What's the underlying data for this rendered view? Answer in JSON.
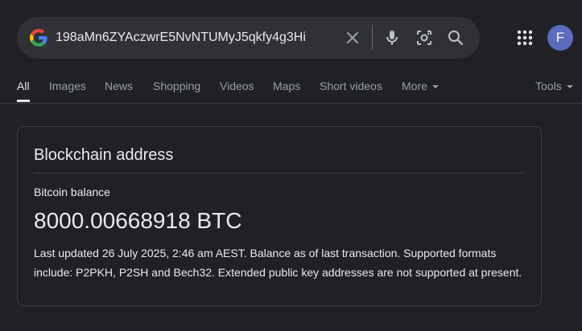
{
  "search": {
    "query": "198aMn6ZYAczwrE5NvNTUMyJ5qkfy4g3Hi",
    "icons": [
      "google-logo",
      "clear-icon",
      "microphone-icon",
      "camera-lens-icon",
      "search-icon"
    ]
  },
  "account": {
    "initial": "F",
    "avatar_color": "#5c6bc0"
  },
  "tabs": [
    {
      "label": "All"
    },
    {
      "label": "Images"
    },
    {
      "label": "News"
    },
    {
      "label": "Shopping"
    },
    {
      "label": "Videos"
    },
    {
      "label": "Maps"
    },
    {
      "label": "Short videos"
    },
    {
      "label": "More"
    }
  ],
  "tools_label": "Tools",
  "card": {
    "title": "Blockchain address",
    "subtitle": "Bitcoin balance",
    "balance": "8000.00668918 BTC",
    "note_line1": "Last updated 26 July 2025, 2:46 am AEST. Balance as of last transaction. Supported formats",
    "note_line2": "include: P2PKH, P2SH and Bech32. Extended public key addresses are not supported at present."
  },
  "colors": {
    "background": "#202124",
    "searchbar": "#303134",
    "text": "#e8eaed",
    "muted": "#9aa0a6"
  }
}
